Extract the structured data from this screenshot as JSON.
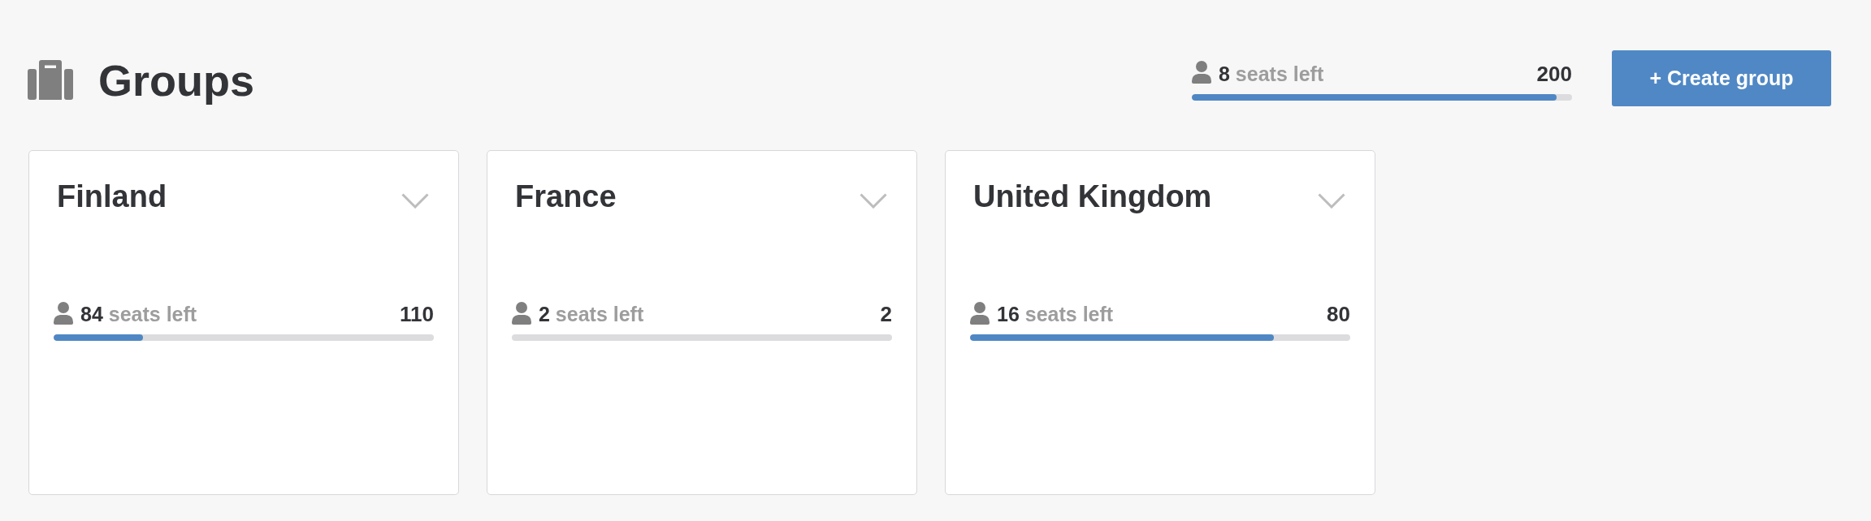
{
  "header": {
    "title": "Groups",
    "seats": {
      "count": "8",
      "label": "seats left",
      "total": "200",
      "level": 0.96
    },
    "create_button": "+ Create group"
  },
  "groups": [
    {
      "name": "Finland",
      "expanded": false,
      "seats": {
        "count": "84",
        "label": "seats left",
        "total": "110",
        "level": 0.236
      }
    },
    {
      "name": "France",
      "expanded": false,
      "seats": {
        "count": "2",
        "label": "seats left",
        "total": "2"
      }
    },
    {
      "name": "United Kingdom",
      "expanded": false,
      "seats": {
        "count": "16",
        "label": "seats left",
        "total": "80",
        "level": 0.8
      }
    }
  ]
}
